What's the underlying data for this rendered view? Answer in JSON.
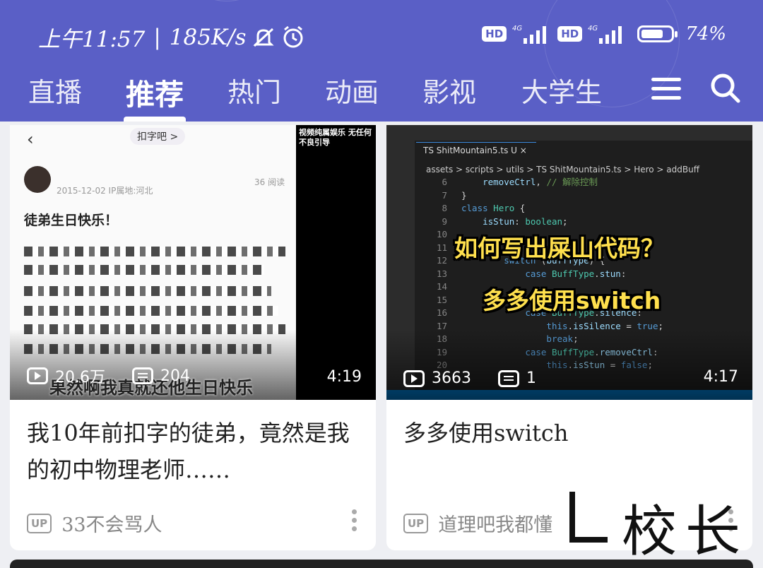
{
  "status_bar": {
    "time": "上午11:57",
    "speed": "185K/s",
    "sim1": "HD",
    "sim2": "HD",
    "network": "4G",
    "battery": "74%",
    "battery_level": 0.74
  },
  "tabs": [
    "直播",
    "推荐",
    "热门",
    "动画",
    "影视",
    "大学生"
  ],
  "active_tab": "推荐",
  "icons": {
    "menu": "menu-icon",
    "search": "search-icon"
  },
  "cards": [
    {
      "thumbnail": {
        "group": "扣字吧 >",
        "date": "2015-12-02  IP属地:河北",
        "reads": "36 阅读",
        "post_text": "徒弟生日快乐！",
        "overlay_caption": "果然啊我真就还他生日快乐",
        "corner_note": "视频纯属娱乐 无任何不良引导"
      },
      "views": "20.6万",
      "comments": "204",
      "duration": "4:19",
      "title": "我10年前扣字的徒弟，竟然是我的初中物理老师……",
      "uploader": "33不会骂人"
    },
    {
      "thumbnail": {
        "tab_file": "TS ShitMountain5.ts U ×",
        "breadcrumb": "assets > scripts > utils > TS ShitMountain5.ts > Hero > addBuff",
        "caption_line1": "如何写出屎山代码？",
        "caption_line2": "多多使用switch"
      },
      "views": "3663",
      "comments": "1",
      "duration": "4:17",
      "title": "多多使用switch",
      "uploader": "道理吧我都懂"
    }
  ],
  "watermark": "校长"
}
